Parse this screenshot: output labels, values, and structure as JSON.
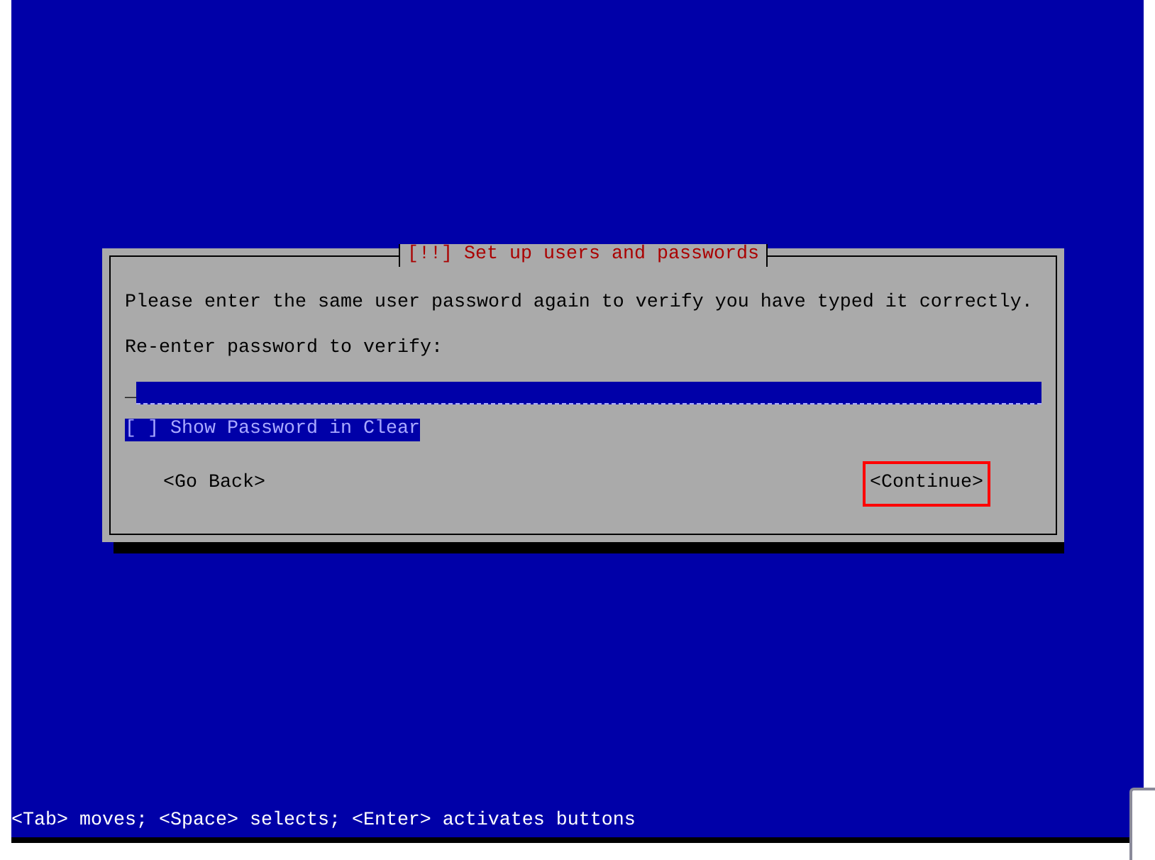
{
  "dialog": {
    "title": "[!!] Set up users and passwords",
    "message": "Please enter the same user password again to verify you have typed it correctly.",
    "prompt": "Re-enter password to verify:",
    "password_field": {
      "cursor": "_",
      "focused": false
    },
    "checkbox": {
      "label": "[ ] Show Password in Clear",
      "checked": false,
      "selected": true
    },
    "buttons": [
      {
        "label": "<Go Back>",
        "selected": false
      },
      {
        "label": "<Continue>",
        "selected": true
      }
    ]
  },
  "status_bar": "<Tab> moves; <Space> selects; <Enter> activates buttons"
}
